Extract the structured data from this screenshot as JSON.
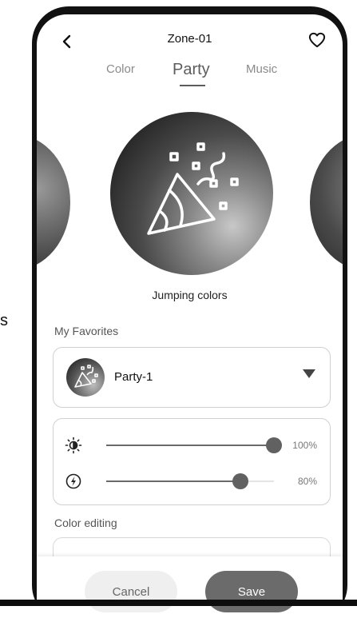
{
  "side_text": "s",
  "header": {
    "title": "Zone-01"
  },
  "tabs": [
    {
      "label": "Color",
      "active": false
    },
    {
      "label": "Party",
      "active": true
    },
    {
      "label": "Music",
      "active": false
    }
  ],
  "scene": {
    "name": "Jumping colors"
  },
  "favorites": {
    "label": "My Favorites",
    "selected": "Party-1"
  },
  "sliders": {
    "brightness": {
      "value": 100,
      "display": "100%"
    },
    "speed": {
      "value": 80,
      "display": "80%"
    }
  },
  "color_editing": {
    "label": "Color editing"
  },
  "footer": {
    "cancel_label": "Cancel",
    "save_label": "Save"
  }
}
